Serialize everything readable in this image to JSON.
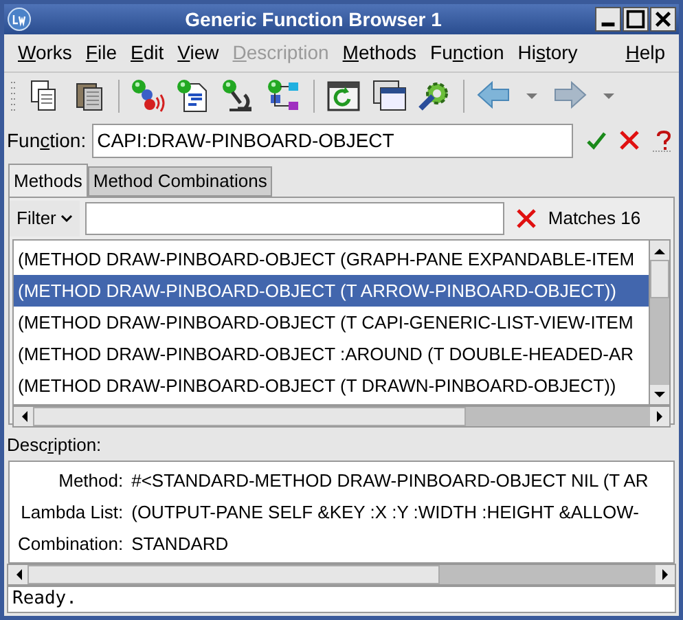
{
  "window": {
    "title": "Generic Function Browser 1"
  },
  "menu": [
    {
      "key": "W",
      "post": "orks",
      "disabled": false
    },
    {
      "key": "F",
      "post": "ile",
      "disabled": false
    },
    {
      "key": "E",
      "post": "dit",
      "disabled": false
    },
    {
      "key": "V",
      "post": "iew",
      "disabled": false
    },
    {
      "key": "D",
      "post": "escription",
      "disabled": true
    },
    {
      "key": "M",
      "post": "ethods",
      "disabled": false
    },
    {
      "pre": "Fu",
      "key": "n",
      "post": "ction",
      "disabled": false
    },
    {
      "pre": "Hi",
      "key": "s",
      "post": "tory",
      "disabled": false
    },
    {
      "key": "H",
      "post": "elp",
      "disabled": false
    }
  ],
  "toolbar": [
    {
      "kind": "copy"
    },
    {
      "kind": "paste"
    },
    {
      "kind": "sep"
    },
    {
      "kind": "ball-sound"
    },
    {
      "kind": "ball-doc"
    },
    {
      "kind": "ball-scope"
    },
    {
      "kind": "ball-tree"
    },
    {
      "kind": "sep"
    },
    {
      "kind": "refresh"
    },
    {
      "kind": "windows"
    },
    {
      "kind": "gear"
    },
    {
      "kind": "sep"
    },
    {
      "kind": "back"
    },
    {
      "kind": "drop"
    },
    {
      "kind": "forward"
    },
    {
      "kind": "drop"
    }
  ],
  "function": {
    "label": {
      "pre": "Fun",
      "key": "c",
      "post": "tion:"
    },
    "value": "CAPI:DRAW-PINBOARD-OBJECT"
  },
  "tabs": [
    {
      "label": "Methods",
      "selected": true
    },
    {
      "label": "Method Combinations",
      "selected": false
    }
  ],
  "filter": {
    "label": "Filter",
    "matches": "Matches 16"
  },
  "methods": [
    {
      "text": "(METHOD DRAW-PINBOARD-OBJECT (GRAPH-PANE EXPANDABLE-ITEM",
      "selected": false
    },
    {
      "text": "(METHOD DRAW-PINBOARD-OBJECT (T ARROW-PINBOARD-OBJECT))",
      "selected": true
    },
    {
      "text": "(METHOD DRAW-PINBOARD-OBJECT (T CAPI-GENERIC-LIST-VIEW-ITEM",
      "selected": false
    },
    {
      "text": "(METHOD DRAW-PINBOARD-OBJECT :AROUND (T DOUBLE-HEADED-AR",
      "selected": false
    },
    {
      "text": "(METHOD DRAW-PINBOARD-OBJECT (T DRAWN-PINBOARD-OBJECT))",
      "selected": false
    }
  ],
  "description": {
    "label": {
      "pre": "Desc",
      "key": "r",
      "post": "iption:"
    },
    "fields": [
      {
        "label": "Method:",
        "value": "#<STANDARD-METHOD DRAW-PINBOARD-OBJECT NIL (T AR"
      },
      {
        "label": "Lambda List:",
        "value": "(OUTPUT-PANE SELF &KEY :X :Y :WIDTH :HEIGHT &ALLOW-"
      },
      {
        "label": "Combination:",
        "value": "STANDARD"
      }
    ]
  },
  "status_bar": "Ready."
}
